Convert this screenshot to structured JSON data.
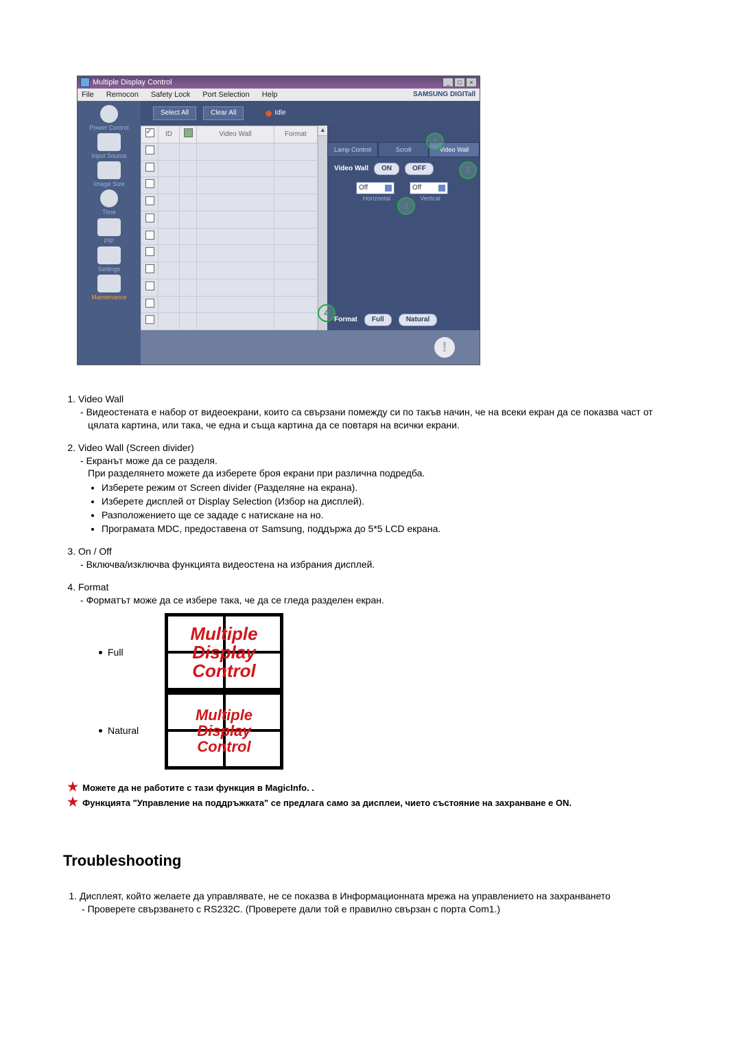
{
  "screenshot": {
    "title": "Multiple Display Control",
    "win_buttons": [
      "_",
      "□",
      "×"
    ],
    "menu": [
      "File",
      "Remocon",
      "Safety Lock",
      "Port Selection",
      "Help"
    ],
    "brand": "SAMSUNG DIGITall",
    "sidebar": [
      {
        "label": "Power Control"
      },
      {
        "label": "Input Source"
      },
      {
        "label": "Image Size"
      },
      {
        "label": "Time"
      },
      {
        "label": "PIP"
      },
      {
        "label": "Settings"
      },
      {
        "label": "Maintenance",
        "active": true
      }
    ],
    "toolbar": {
      "select_all": "Select All",
      "clear_all": "Clear All",
      "idle": "Idle"
    },
    "table": {
      "cols": [
        "",
        "ID",
        "",
        "Video Wall",
        "Format"
      ]
    },
    "tabs": {
      "lamp": "Lamp Control",
      "scroll": "Scroll",
      "vw": "Video Wall"
    },
    "vw": {
      "label": "Video Wall",
      "on": "ON",
      "off": "OFF",
      "h_sel": "Off",
      "v_sel": "Off",
      "h_sub": "Horizontal",
      "v_sub": "Vertical"
    },
    "format": {
      "label": "Format",
      "full": "Full",
      "natural": "Natural"
    },
    "markers": {
      "m1": "1",
      "m2": "2",
      "m3": "3",
      "m4": "4"
    },
    "thumb_lines": [
      "Multiple",
      "Display",
      "Control"
    ]
  },
  "body": {
    "i1_title": "Video Wall",
    "i1_p": "Видеостената е набор от видеоекрани, които са свързани помежду си по такъв начин, че на всеки екран да се показва част от цялата картина, или така, че една и съща картина да се повтаря на всички екрани.",
    "i2_title": "Video Wall (Screen divider)",
    "i2_d1": "Екранът може да се разделя.",
    "i2_d2": "При разделянето можете да изберете броя екрани при различна подредба.",
    "i2_b1": "Изберете режим от Screen divider (Разделяне на екрана).",
    "i2_b2": "Изберете дисплей от Display Selection (Избор на дисплей).",
    "i2_b3": "Разположението ще се зададе с натискане на но.",
    "i2_b4": "Програмата MDC, предоставена от Samsung, поддържа до 5*5 LCD екрана.",
    "i3_title": "On / Off",
    "i3_d1": "Включва/изключва функцията видеостена на избрания дисплей.",
    "i4_title": "Format",
    "i4_d1": "Форматът може да се избере така, че да се гледа разделен екран.",
    "fmt_full": "Full",
    "fmt_natural": "Natural",
    "note1": "Можете да не работите с тази функция в MagicInfo. .",
    "note2": "Функцията \"Управление на поддръжката\" се предлага само за дисплеи, чието състояние на захранване е ON.",
    "ts_heading": "Troubleshooting",
    "ts1": "Дисплеят, който желаете да управлявате, не се показва в Информационната мрежа на управлението на захранването",
    "ts1_d1": "Проверете свързването с RS232C. (Проверете дали той е правилно свързан с порта Com1.)"
  }
}
